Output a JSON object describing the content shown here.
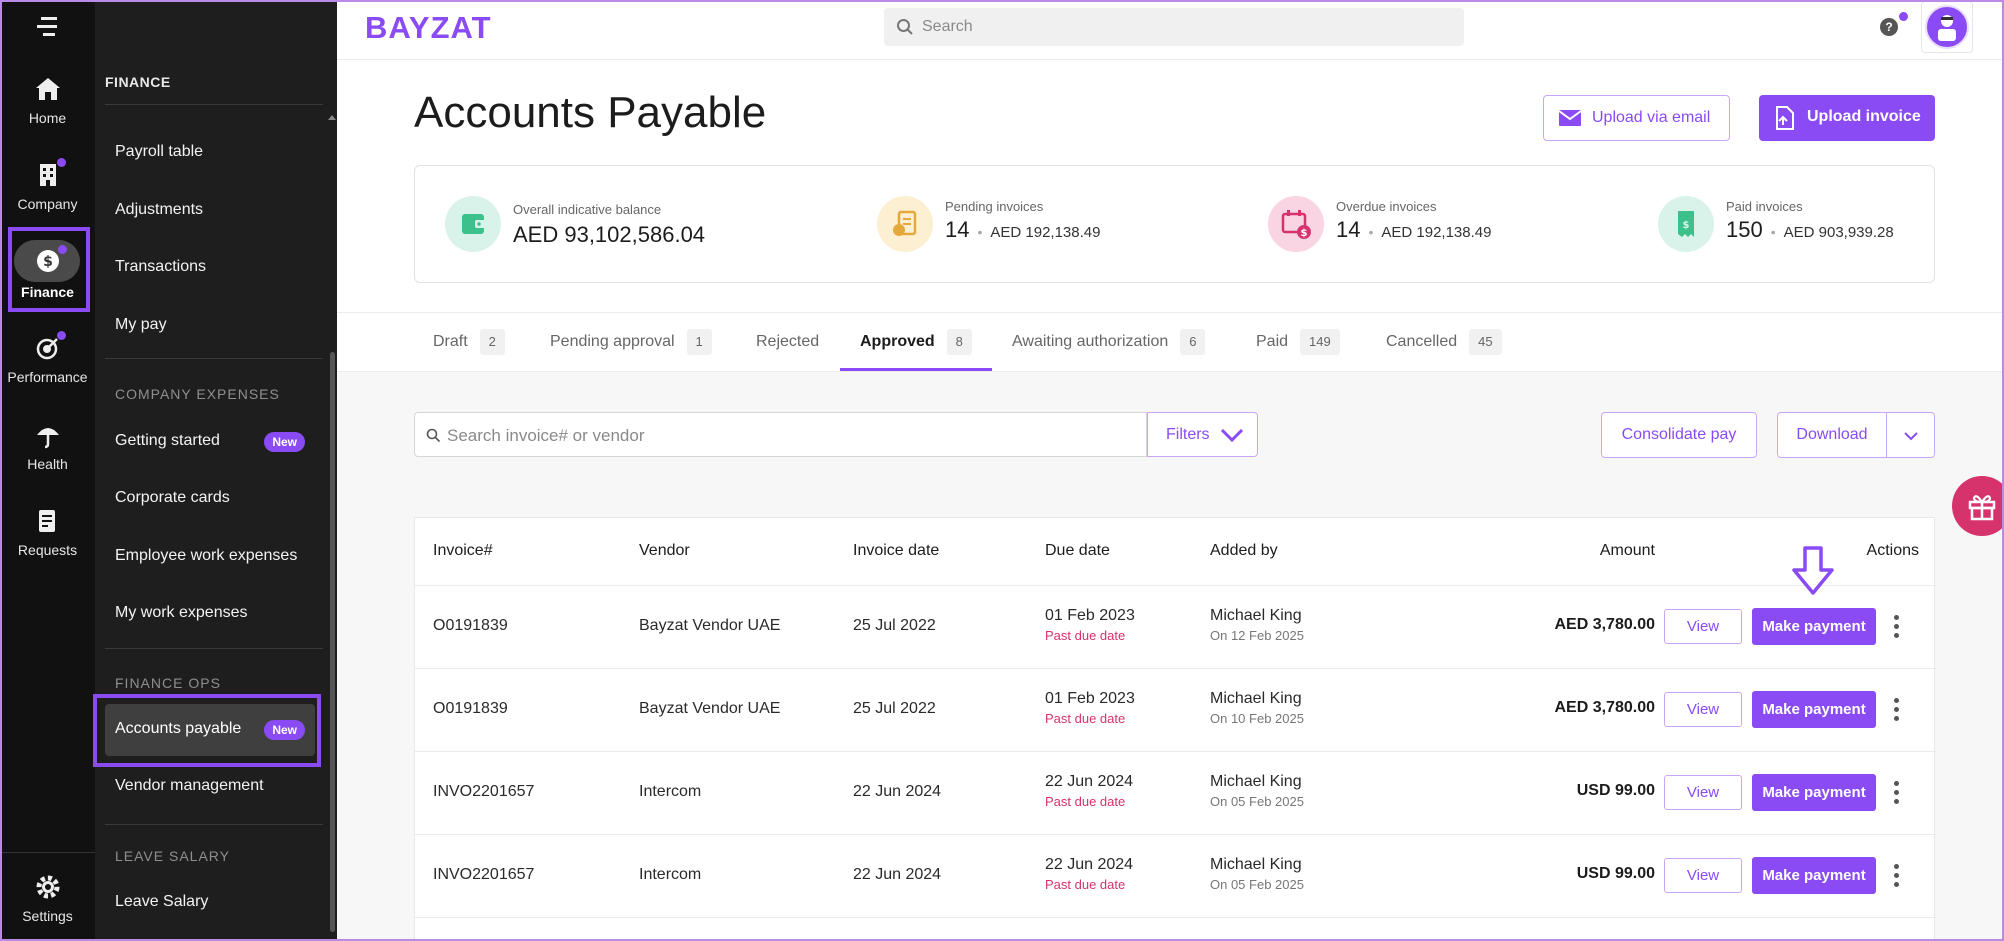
{
  "rail": {
    "items": [
      {
        "label": "Home"
      },
      {
        "label": "Company"
      },
      {
        "label": "Finance"
      },
      {
        "label": "Performance"
      },
      {
        "label": "Health"
      },
      {
        "label": "Requests"
      },
      {
        "label": "Settings"
      }
    ]
  },
  "menu": {
    "title": "FINANCE",
    "items_top": [
      "Payroll table",
      "Adjustments",
      "Transactions",
      "My pay"
    ],
    "section_expenses": "COMPANY EXPENSES",
    "expenses": [
      {
        "label": "Getting started",
        "badge": "New"
      },
      {
        "label": "Corporate cards"
      },
      {
        "label": "Employee work expenses"
      },
      {
        "label": "My work expenses"
      }
    ],
    "section_ops": "FINANCE OPS",
    "ops": [
      {
        "label": "Accounts payable",
        "badge": "New"
      },
      {
        "label": "Vendor management"
      }
    ],
    "section_leave": "LEAVE SALARY",
    "leave": [
      {
        "label": "Leave Salary"
      }
    ]
  },
  "topbar": {
    "logo": "BAYZAT",
    "search_placeholder": "Search",
    "help": "?"
  },
  "header": {
    "title": "Accounts Payable",
    "upload_email": "Upload via email",
    "upload_invoice": "Upload invoice"
  },
  "summary": [
    {
      "label": "Overall indicative balance",
      "count": "",
      "amount": "AED 93,102,586.04"
    },
    {
      "label": "Pending invoices",
      "count": "14",
      "amount": "AED 192,138.49"
    },
    {
      "label": "Overdue invoices",
      "count": "14",
      "amount": "AED 192,138.49"
    },
    {
      "label": "Paid invoices",
      "count": "150",
      "amount": "AED 903,939.28"
    }
  ],
  "tabs": [
    {
      "label": "Draft",
      "count": "2"
    },
    {
      "label": "Pending approval",
      "count": "1"
    },
    {
      "label": "Rejected",
      "count": ""
    },
    {
      "label": "Approved",
      "count": "8"
    },
    {
      "label": "Awaiting authorization",
      "count": "6"
    },
    {
      "label": "Paid",
      "count": "149"
    },
    {
      "label": "Cancelled",
      "count": "45"
    }
  ],
  "toolbar": {
    "search_placeholder": "Search invoice# or vendor",
    "filters": "Filters",
    "consolidate": "Consolidate pay",
    "download": "Download"
  },
  "table": {
    "headers": {
      "invoice": "Invoice#",
      "vendor": "Vendor",
      "invoice_date": "Invoice date",
      "due_date": "Due date",
      "added_by": "Added by",
      "amount": "Amount",
      "actions": "Actions"
    },
    "rows": [
      {
        "invoice": "O0191839",
        "vendor": "Bayzat Vendor UAE",
        "invoice_date": "25 Jul 2022",
        "due_date": "01 Feb 2023",
        "due_note": "Past due date",
        "added_by": "Michael King",
        "added_on": "On 12 Feb 2025",
        "amount": "AED 3,780.00",
        "view": "View",
        "pay": "Make payment"
      },
      {
        "invoice": "O0191839",
        "vendor": "Bayzat Vendor UAE",
        "invoice_date": "25 Jul 2022",
        "due_date": "01 Feb 2023",
        "due_note": "Past due date",
        "added_by": "Michael King",
        "added_on": "On 10 Feb 2025",
        "amount": "AED 3,780.00",
        "view": "View",
        "pay": "Make payment"
      },
      {
        "invoice": "INVO2201657",
        "vendor": "Intercom",
        "invoice_date": "22 Jun 2024",
        "due_date": "22 Jun 2024",
        "due_note": "Past due date",
        "added_by": "Michael King",
        "added_on": "On 05 Feb 2025",
        "amount": "USD 99.00",
        "view": "View",
        "pay": "Make payment"
      },
      {
        "invoice": "INVO2201657",
        "vendor": "Intercom",
        "invoice_date": "22 Jun 2024",
        "due_date": "22 Jun 2024",
        "due_note": "Past due date",
        "added_by": "Michael King",
        "added_on": "On 05 Feb 2025",
        "amount": "USD 99.00",
        "view": "View",
        "pay": "Make payment"
      }
    ]
  },
  "colors": {
    "accent": "#8a4bf5",
    "danger": "#d6336c",
    "sidebar_dark": "#111111",
    "panel_dark": "#1e1e1e"
  }
}
